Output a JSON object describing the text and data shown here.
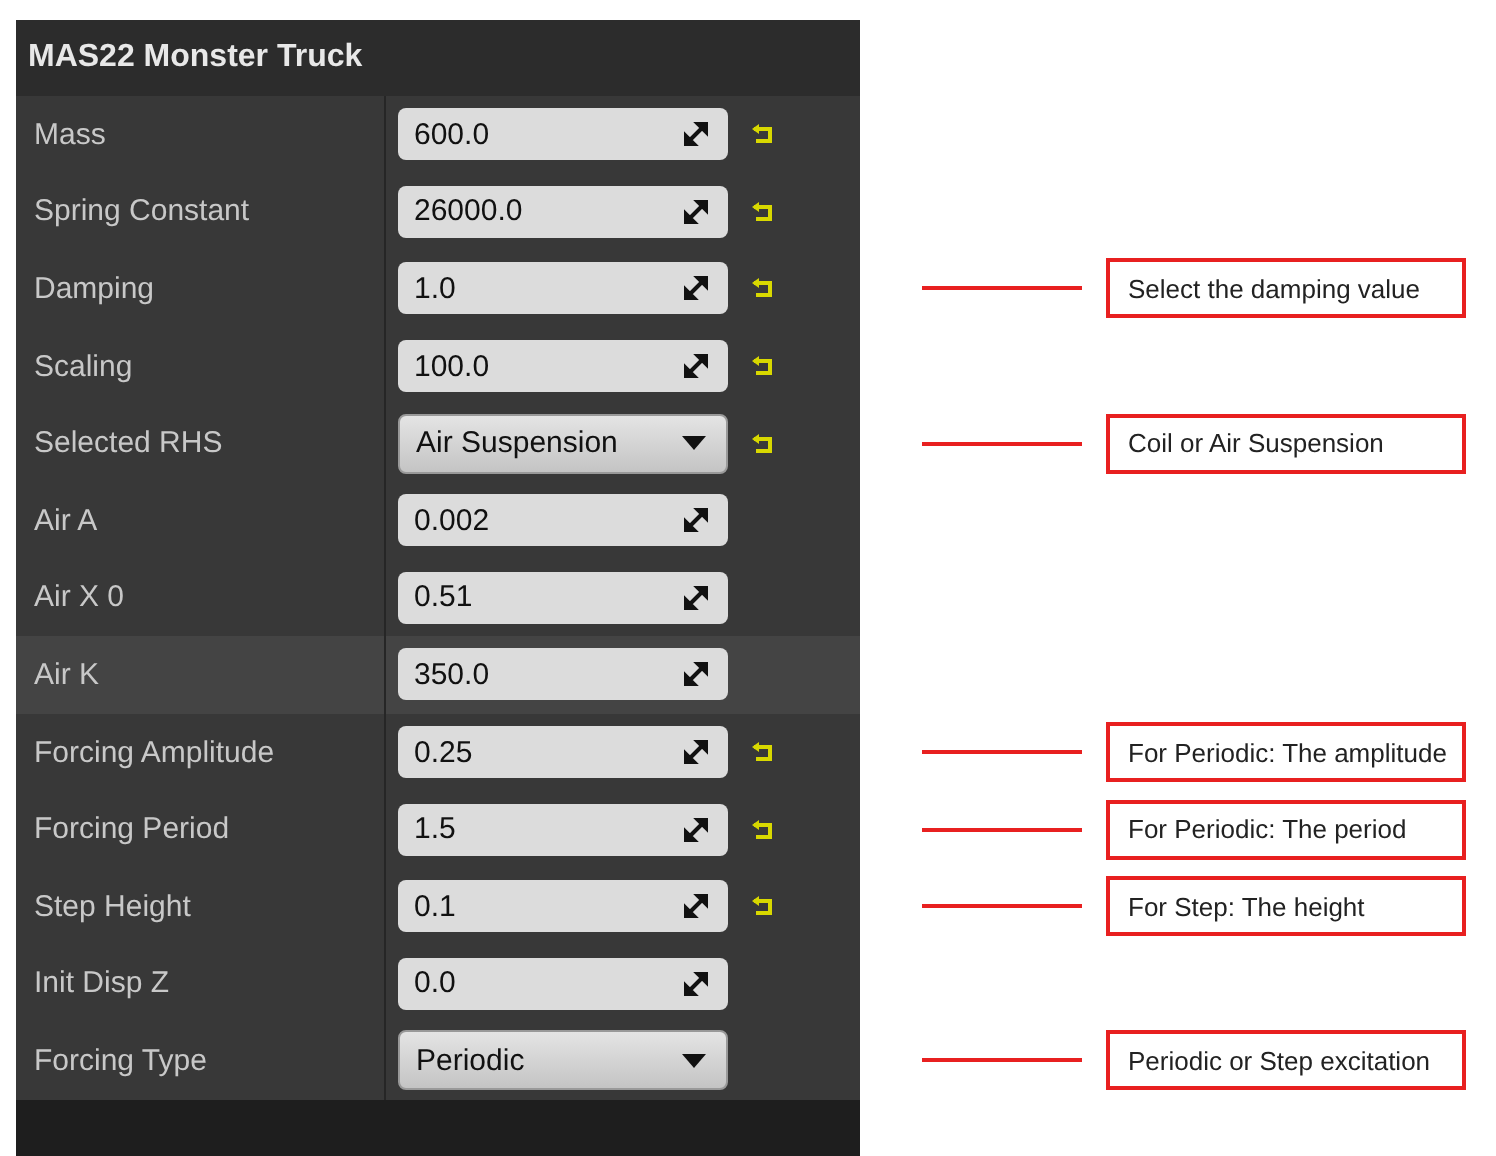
{
  "panel": {
    "title": "MAS22 Monster Truck"
  },
  "properties": [
    {
      "label": "Mass",
      "kind": "number",
      "value": "600.0",
      "reset": true,
      "hovered": false
    },
    {
      "label": "Spring Constant",
      "kind": "number",
      "value": "26000.0",
      "reset": true,
      "hovered": false
    },
    {
      "label": "Damping",
      "kind": "number",
      "value": "1.0",
      "reset": true,
      "hovered": false,
      "annotation": "Select the damping value"
    },
    {
      "label": "Scaling",
      "kind": "number",
      "value": "100.0",
      "reset": true,
      "hovered": false
    },
    {
      "label": "Selected RHS",
      "kind": "dropdown",
      "value": "Air Suspension",
      "reset": true,
      "hovered": false,
      "annotation": "Coil or Air Suspension"
    },
    {
      "label": "Air A",
      "kind": "number",
      "value": "0.002",
      "reset": false,
      "hovered": false
    },
    {
      "label": "Air X 0",
      "kind": "number",
      "value": "0.51",
      "reset": false,
      "hovered": false
    },
    {
      "label": "Air K",
      "kind": "number",
      "value": "350.0",
      "reset": false,
      "hovered": true
    },
    {
      "label": "Forcing Amplitude",
      "kind": "number",
      "value": "0.25",
      "reset": true,
      "hovered": false,
      "annotation": "For Periodic: The amplitude"
    },
    {
      "label": "Forcing Period",
      "kind": "number",
      "value": "1.5",
      "reset": true,
      "hovered": false,
      "annotation": "For Periodic: The period"
    },
    {
      "label": "Step Height",
      "kind": "number",
      "value": "0.1",
      "reset": true,
      "hovered": false,
      "annotation": "For Step: The height"
    },
    {
      "label": "Init Disp Z",
      "kind": "number",
      "value": "0.0",
      "reset": false,
      "hovered": false
    },
    {
      "label": "Forcing Type",
      "kind": "dropdown",
      "value": "Periodic",
      "reset": false,
      "hovered": false,
      "annotation": "Periodic or Step excitation"
    }
  ]
}
